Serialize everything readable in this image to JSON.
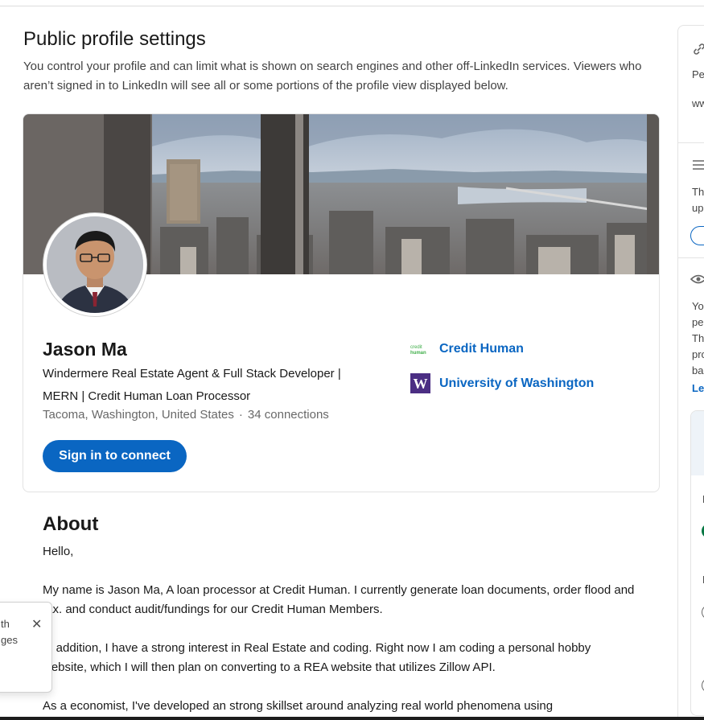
{
  "page": {
    "title": "Public profile settings",
    "description": "You control your profile and can limit what is shown on search engines and other off-LinkedIn services. Viewers who aren’t signed in to LinkedIn will see all or some portions of the profile view displayed below."
  },
  "profile": {
    "name": "Jason Ma",
    "headline": "Windermere Real Estate Agent & Full Stack Developer | MERN | Credit Human Loan Processor",
    "location": "Tacoma, Washington, United States",
    "separator": "·",
    "connections": "34 connections",
    "connect_button": "Sign in to connect",
    "affiliations": [
      {
        "label": "Credit Human",
        "logo_text": "credit human",
        "icon": "credit-human-logo"
      },
      {
        "label": "University of Washington",
        "logo_text": "W",
        "icon": "uw-logo"
      }
    ]
  },
  "about": {
    "title": "About",
    "paragraphs": [
      "Hello,",
      "My name is Jason Ma, A loan processor at Credit Human. I currently generate loan documents, order flood and tax. and conduct audit/fundings for our Credit Human Members.",
      "In addition, I have a strong interest in Real Estate and coding. Right now I am coding a personal hobby website, which I will then plan on converting to a REA website that utilizes Zillow API.",
      "As a economist, I've developed an strong skillset around analyzing real world phenomena using"
    ]
  },
  "toast": {
    "line1": "th",
    "line2": "ges",
    "close": "✕"
  },
  "right_panel": {
    "link_text_1": "Pe",
    "link_text_2": "ww",
    "section2_line1": "Th",
    "section2_line2": "up",
    "section3_lines": [
      "You",
      "pe",
      "Th",
      "pro",
      "ba"
    ],
    "learn_more": "Lea",
    "sub_item": "E",
    "sub_item2": "F"
  },
  "colors": {
    "brand_blue": "#0a66c2",
    "uw_purple": "#4b2e83",
    "credit_human_green": "#3fae49"
  }
}
